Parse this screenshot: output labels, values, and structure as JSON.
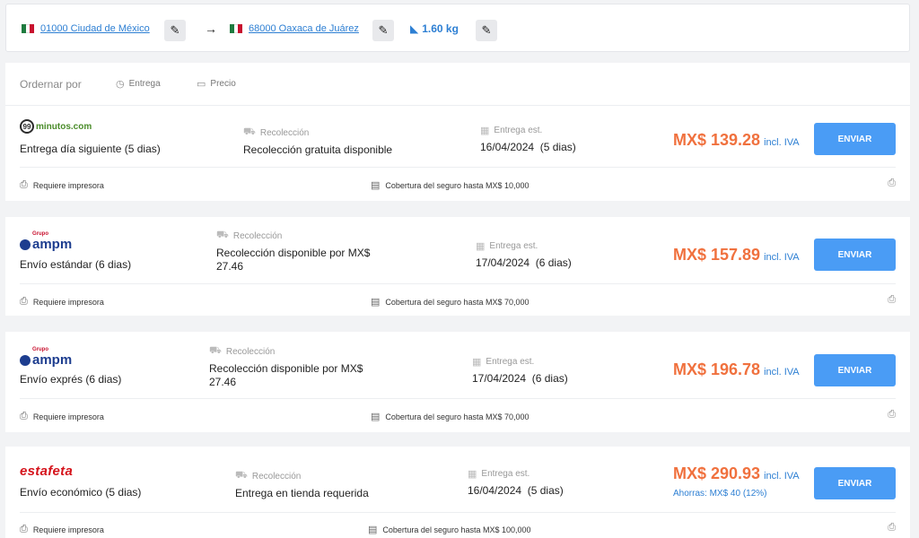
{
  "route": {
    "origin": "01000 Ciudad de México",
    "destination": "68000 Oaxaca de Juárez",
    "weight": "1.60 kg",
    "arrow": "→",
    "edit_icon": "✎"
  },
  "sort": {
    "label": "Ordernar por",
    "options": [
      {
        "label": "Entrega",
        "icon": "clock-icon"
      },
      {
        "label": "Precio",
        "icon": "money-icon"
      }
    ]
  },
  "labels": {
    "pickup": "Recolección",
    "delivery_est": "Entrega est.",
    "send": "ENVIAR",
    "incl_iva": "incl. IVA",
    "requires_printer": "Requiere impresora"
  },
  "carriers": [
    {
      "logo": "minutos.com",
      "logo_prefix": "99",
      "service": "Entrega día siguiente (5 dias)",
      "pickup": "Recolección gratuita disponible",
      "delivery_date": "16/04/2024",
      "delivery_days": "(5 dias)",
      "price": "MX$ 139.28",
      "insurance": "Cobertura del seguro hasta MX$ 10,000"
    },
    {
      "logo": "ampm",
      "logo_prefix": "Grupo",
      "service": "Envío estándar (6 dias)",
      "pickup": "Recolección disponible por MX$ 27.46",
      "delivery_date": "17/04/2024",
      "delivery_days": "(6 dias)",
      "price": "MX$ 157.89",
      "insurance": "Cobertura del seguro hasta MX$ 70,000"
    },
    {
      "logo": "ampm",
      "logo_prefix": "Grupo",
      "service": "Envío exprés (6 dias)",
      "pickup": "Recolección disponible por MX$ 27.46",
      "delivery_date": "17/04/2024",
      "delivery_days": "(6 dias)",
      "price": "MX$ 196.78",
      "insurance": "Cobertura del seguro hasta MX$ 70,000"
    },
    {
      "logo": "estafeta",
      "service": "Envío económico (5 dias)",
      "pickup": "Entrega en tienda requerida",
      "delivery_date": "16/04/2024",
      "delivery_days": "(5 dias)",
      "price": "MX$ 290.93",
      "savings": "Ahorras: MX$ 40 (12%)",
      "insurance": "Cobertura del seguro hasta MX$ 100,000"
    }
  ],
  "colors": {
    "price": "#f0713e",
    "accent": "#2d7fd3",
    "button": "#4a9cf5"
  }
}
